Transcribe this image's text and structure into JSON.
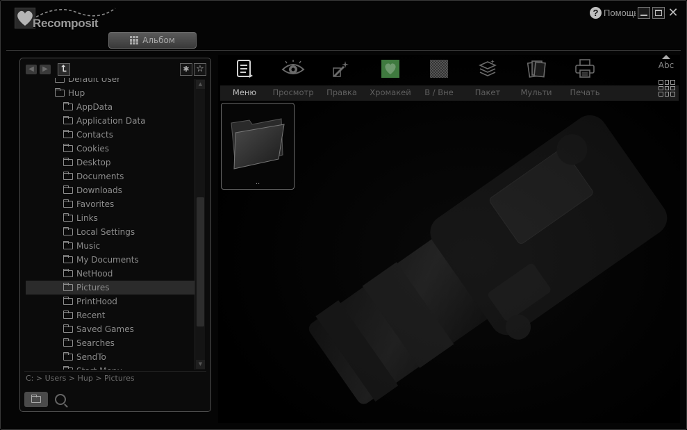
{
  "app": {
    "logo_text": "Recomposit",
    "help_label": "Помощь",
    "album_tab_label": "Альбом"
  },
  "tree": {
    "items": [
      {
        "label": "Default User",
        "level": 1
      },
      {
        "label": "Hup",
        "level": 1
      },
      {
        "label": "AppData",
        "level": 2
      },
      {
        "label": "Application Data",
        "level": 2
      },
      {
        "label": "Contacts",
        "level": 2
      },
      {
        "label": "Cookies",
        "level": 2
      },
      {
        "label": "Desktop",
        "level": 2
      },
      {
        "label": "Documents",
        "level": 2
      },
      {
        "label": "Downloads",
        "level": 2
      },
      {
        "label": "Favorites",
        "level": 2
      },
      {
        "label": "Links",
        "level": 2
      },
      {
        "label": "Local Settings",
        "level": 2
      },
      {
        "label": "Music",
        "level": 2
      },
      {
        "label": "My Documents",
        "level": 2
      },
      {
        "label": "NetHood",
        "level": 2
      },
      {
        "label": "Pictures",
        "level": 2,
        "selected": true
      },
      {
        "label": "PrintHood",
        "level": 2
      },
      {
        "label": "Recent",
        "level": 2
      },
      {
        "label": "Saved Games",
        "level": 2
      },
      {
        "label": "Searches",
        "level": 2
      },
      {
        "label": "SendTo",
        "level": 2
      },
      {
        "label": "Start Menu",
        "level": 2
      }
    ]
  },
  "path": {
    "text": "C: > Users > Hup > Pictures"
  },
  "toolbar": {
    "tools": [
      {
        "label": "Меню",
        "icon": "menu-document-icon",
        "active": true
      },
      {
        "label": "Просмотр",
        "icon": "eye-icon"
      },
      {
        "label": "Правка",
        "icon": "magic-wand-icon"
      },
      {
        "label": "Хромакей",
        "icon": "chromakey-heart-icon"
      },
      {
        "label": "В / Вне",
        "icon": "in-out-checker-icon"
      },
      {
        "label": "Пакет",
        "icon": "batch-stack-icon"
      },
      {
        "label": "Мульти",
        "icon": "multi-pages-icon"
      },
      {
        "label": "Печать",
        "icon": "printer-icon"
      }
    ],
    "sort_label": "Abc"
  },
  "gallery": {
    "items": [
      {
        "caption": "..",
        "icon": "folder-icon"
      }
    ]
  },
  "colors": {
    "background": "#000000",
    "panel_border": "#4d4d4d",
    "selected_row": "#2b2b2b",
    "active_tool_text": "#bdbdbd",
    "chromakey_green": "#3f7a3f"
  }
}
